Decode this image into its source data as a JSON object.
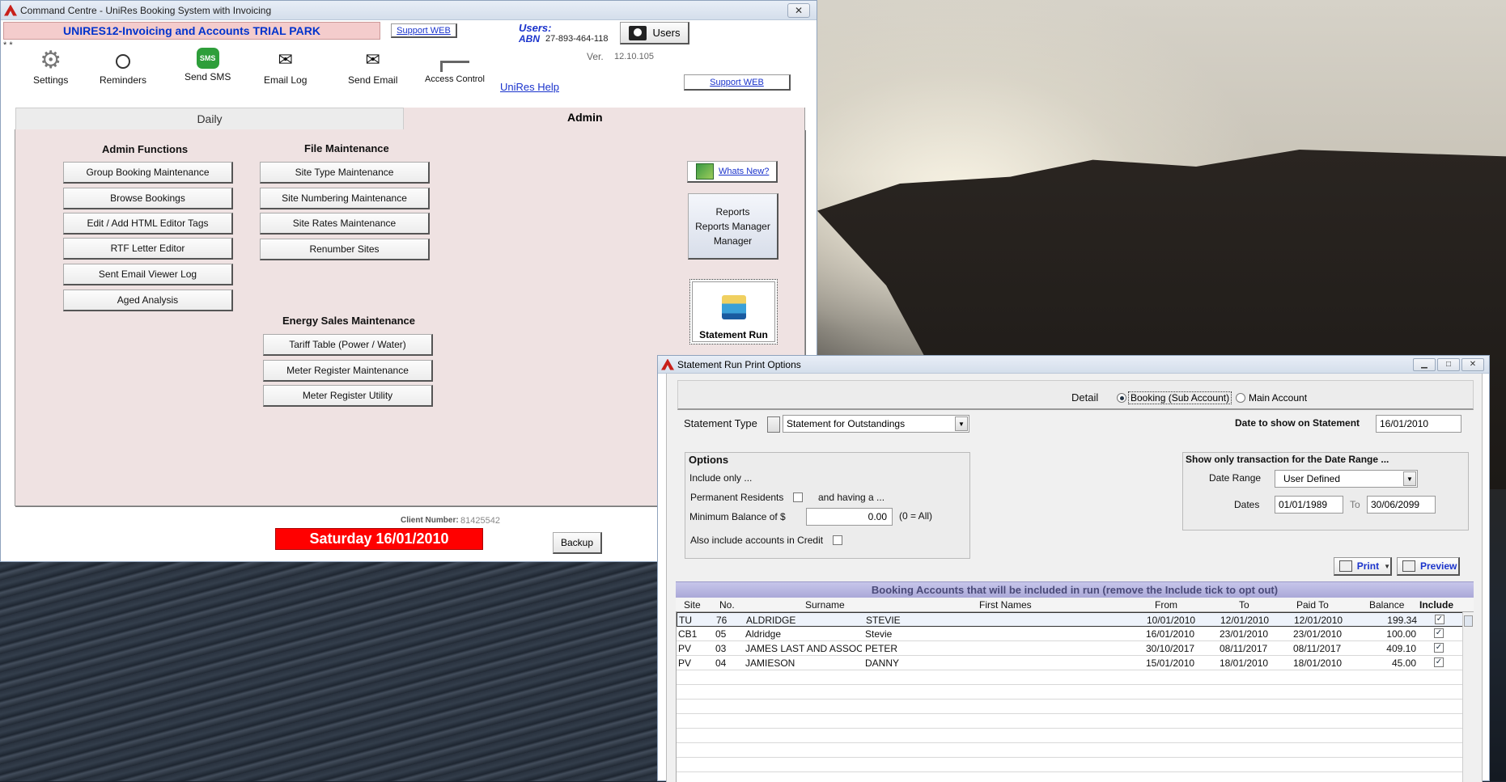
{
  "main_window": {
    "title": "Command Centre - UniRes Booking System with Invoicing",
    "close_glyph": "✕",
    "park_name": "UNIRES12-Invoicing and Accounts TRIAL PARK",
    "support_web_top": "Support WEB",
    "stars": "* *",
    "users_label": "Users:",
    "abn_label": "ABN",
    "abn_value": "27-893-464-118",
    "users_button": "Users",
    "version_label": "Ver.",
    "version_value": "12.10.105",
    "support_web_right": "Support WEB",
    "unires_help": "UniRes Help",
    "toolbar": [
      {
        "label": "Settings",
        "icon": "gear-icon"
      },
      {
        "label": "Reminders",
        "icon": "alarm-clock-icon"
      },
      {
        "label": "Send SMS",
        "icon": "sms-icon"
      },
      {
        "label": "Email Log",
        "icon": "email-log-icon"
      },
      {
        "label": "Send Email",
        "icon": "send-email-icon"
      },
      {
        "label": "Access Control",
        "icon": "access-gate-icon"
      }
    ],
    "sms_icon_text": "SMS",
    "tabs": {
      "daily": "Daily",
      "admin": "Admin"
    },
    "admin_functions": {
      "title": "Admin Functions",
      "buttons": [
        "Group Booking Maintenance",
        "Browse Bookings",
        "Edit / Add HTML Editor Tags",
        "RTF Letter Editor",
        "Sent Email Viewer Log",
        "Aged Analysis"
      ]
    },
    "file_maintenance": {
      "title": "File Maintenance",
      "buttons": [
        "Site Type Maintenance",
        "Site Numbering Maintenance",
        "Site Rates Maintenance",
        "Renumber Sites"
      ]
    },
    "energy_sales": {
      "title": "Energy Sales Maintenance",
      "buttons": [
        "Tariff Table (Power / Water)",
        "Meter Register Maintenance",
        "Meter Register Utility"
      ]
    },
    "whats_new": "Whats New?",
    "reports_lines": [
      "Reports",
      "Reports Manager",
      "Manager"
    ],
    "statement_run": "Statement Run",
    "client_number_label": "Client Number:",
    "client_number_value": "81425542",
    "date_banner": "Saturday 16/01/2010",
    "backup": "Backup"
  },
  "statement_window": {
    "title": "Statement Run Print Options",
    "detail_label": "Detail",
    "detail_options": [
      "Booking (Sub Account)",
      "Main Account"
    ],
    "detail_selected": 0,
    "statement_type_label": "Statement Type",
    "statement_type_value": "Statement for Outstandings",
    "date_on_statement_label": "Date to show on Statement",
    "date_on_statement_value": "16/01/2010",
    "options": {
      "title": "Options",
      "include_only": "Include only ...",
      "permanent_residents": "Permanent Residents",
      "permanent_residents_checked": false,
      "and_having": "and having a ...",
      "min_balance_label": "Minimum Balance of  $",
      "min_balance_value": "0.00",
      "min_balance_hint": "(0 = All)",
      "also_credit": "Also include accounts in Credit",
      "also_credit_checked": false
    },
    "date_range_group": {
      "title": "Show only transaction for the Date Range ...",
      "date_range_label": "Date Range",
      "date_range_value": "User Defined",
      "dates_label": "Dates",
      "from": "01/01/1989",
      "to_label": "To",
      "to": "30/06/2099"
    },
    "print_button": "Print",
    "preview_button": "Preview",
    "grid": {
      "caption": "Booking Accounts that will be included in run  (remove the Include tick to opt out)",
      "columns": [
        "Site",
        "No.",
        "Surname",
        "First Names",
        "From",
        "To",
        "Paid To",
        "Balance",
        "Include"
      ],
      "rows": [
        {
          "site": "TU",
          "no": "76",
          "surname": "ALDRIDGE",
          "first": "STEVIE",
          "from": "10/01/2010",
          "to": "12/01/2010",
          "paid_to": "12/01/2010",
          "balance": "199.34",
          "include": true
        },
        {
          "site": "CB1",
          "no": "05",
          "surname": "Aldridge",
          "first": "Stevie",
          "from": "16/01/2010",
          "to": "23/01/2010",
          "paid_to": "23/01/2010",
          "balance": "100.00",
          "include": true
        },
        {
          "site": "PV",
          "no": "03",
          "surname": "JAMES LAST AND ASSOCI",
          "first": "PETER",
          "from": "30/10/2017",
          "to": "08/11/2017",
          "paid_to": "08/11/2017",
          "balance": "409.10",
          "include": true
        },
        {
          "site": "PV",
          "no": "04",
          "surname": "JAMIESON",
          "first": "DANNY",
          "from": "15/01/2010",
          "to": "18/01/2010",
          "paid_to": "18/01/2010",
          "balance": "45.00",
          "include": true
        }
      ]
    }
  }
}
